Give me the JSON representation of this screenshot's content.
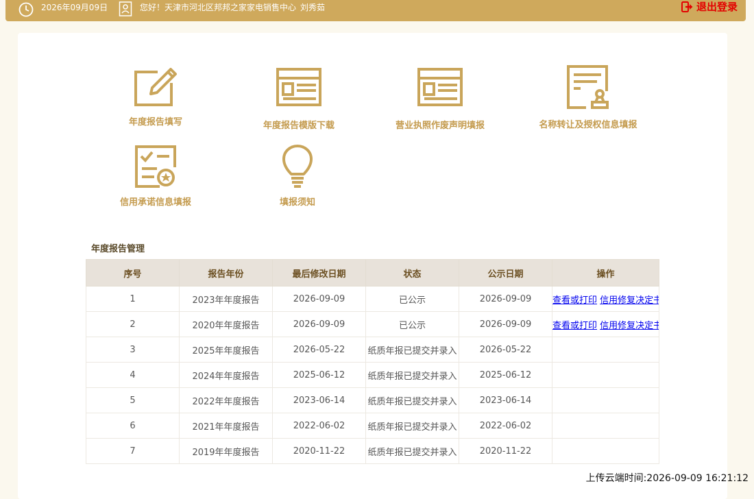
{
  "header": {
    "date": "2026年09月09日",
    "greeting": "您好！天津市河北区邦邦之家家电销售中心",
    "user_name": "刘秀茹",
    "logout_label": "退出登录",
    "colors": {
      "bar": "#cfa95c",
      "logout": "#e30000"
    }
  },
  "tiles": [
    {
      "label": "年度报告填写",
      "icon": "pencil-edit-icon"
    },
    {
      "label": "年度报告模版下载",
      "icon": "template-window-icon"
    },
    {
      "label": "营业执照作废声明填报",
      "icon": "license-window-icon"
    },
    {
      "label": "名称转让及授权信息填报",
      "icon": "document-stamp-icon"
    },
    {
      "label": "信用承诺信息填报",
      "icon": "checklist-badge-icon"
    },
    {
      "label": "填报须知",
      "icon": "lightbulb-icon"
    }
  ],
  "section": {
    "title": "年度报告管理"
  },
  "table": {
    "headers": [
      "序号",
      "报告年份",
      "最后修改日期",
      "状态",
      "公示日期",
      "操作"
    ],
    "rows": [
      [
        "1",
        "2023年年度报告",
        "2026-09-09",
        "已公示",
        "2026-09-09"
      ],
      [
        "2",
        "2020年年度报告",
        "2026-09-09",
        "已公示",
        "2026-09-09"
      ],
      [
        "3",
        "2025年年度报告",
        "2026-05-22",
        "纸质年报已提交并录入",
        "2026-05-22"
      ],
      [
        "4",
        "2024年年度报告",
        "2025-06-12",
        "纸质年报已提交并录入",
        "2025-06-12"
      ],
      [
        "5",
        "2022年年度报告",
        "2023-06-14",
        "纸质年报已提交并录入",
        "2023-06-14"
      ],
      [
        "6",
        "2021年年度报告",
        "2022-06-02",
        "纸质年报已提交并录入",
        "2022-06-02"
      ],
      [
        "7",
        "2019年年度报告",
        "2020-11-22",
        "纸质年报已提交并录入",
        "2020-11-22"
      ]
    ],
    "action_links": {
      "view_print": "查看或打印",
      "credit_repair": "信用修复决定书"
    }
  },
  "footer": {
    "upload_time": "上传云端时间:2026-09-09 16:21:12"
  }
}
